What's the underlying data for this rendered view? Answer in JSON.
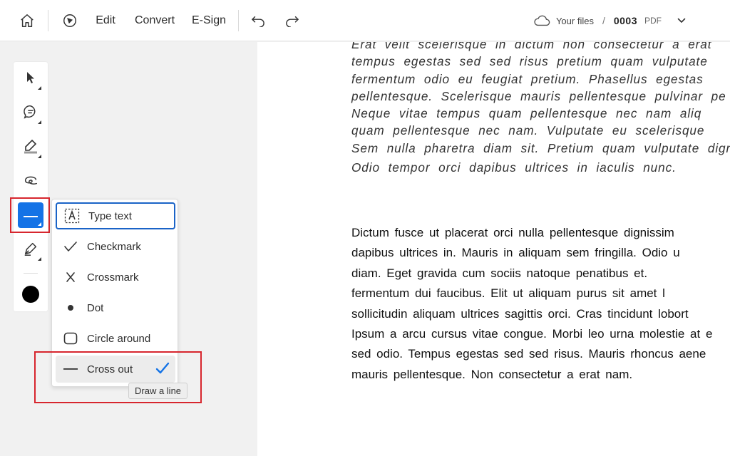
{
  "toolbar": {
    "home_icon": "home-icon",
    "nav_icon": "compass-icon",
    "edit_label": "Edit",
    "convert_label": "Convert",
    "esign_label": "E-Sign",
    "undo_icon": "undo-icon",
    "redo_icon": "redo-icon"
  },
  "file": {
    "cloud_icon": "cloud-icon",
    "location_label": "Your files",
    "separator": "/",
    "name": "0003",
    "type": "PDF",
    "dropdown_icon": "chevron-down-icon"
  },
  "left_tools": [
    {
      "name": "select-tool",
      "icon": "pointer-icon"
    },
    {
      "name": "comment-tool",
      "icon": "comment-icon"
    },
    {
      "name": "highlight-tool",
      "icon": "highlighter-icon"
    },
    {
      "name": "draw-tool",
      "icon": "freehand-icon"
    },
    {
      "name": "markup-tool",
      "icon": "line-icon",
      "active": true
    },
    {
      "name": "sign-tool",
      "icon": "pen-icon"
    }
  ],
  "current_color": "#000000",
  "accent_color": "#1473e6",
  "highlight_color": "#d7262e",
  "menu": {
    "items": [
      {
        "label": "Type text",
        "icon": "type-text-icon",
        "focused": true
      },
      {
        "label": "Checkmark",
        "icon": "checkmark-icon"
      },
      {
        "label": "Crossmark",
        "icon": "crossmark-icon"
      },
      {
        "label": "Dot",
        "icon": "dot-icon"
      },
      {
        "label": "Circle around",
        "icon": "circle-icon"
      },
      {
        "label": "Cross out",
        "icon": "strikeout-line-icon",
        "selected": true
      }
    ],
    "tooltip": "Draw a line"
  },
  "document": {
    "italic_lines": [
      "Erat velit scelerisque in dictum non consectetur a erat",
      "tempus egestas sed sed risus pretium quam vulputate",
      "fermentum odio eu feugiat pretium. Phasellus egestas",
      "pellentesque. Scelerisque mauris pellentesque pulvinar pe",
      "Neque vitae tempus quam pellentesque nec nam aliq",
      "quam pellentesque nec nam. Vulputate eu scelerisque",
      "Sem nulla pharetra diam sit. Pretium quam vulputate dignis",
      "Odio tempor orci dapibus ultrices in iaculis nunc."
    ],
    "normal_lines": [
      "Dictum fusce ut placerat orci nulla pellentesque dignissim",
      "dapibus ultrices in. Mauris in aliquam sem fringilla. Odio u",
      "diam. Eget gravida cum sociis natoque penatibus et.",
      "fermentum dui faucibus. Elit ut aliquam purus sit amet l",
      "sollicitudin aliquam ultrices sagittis orci. Cras tincidunt lobort",
      "Ipsum a arcu cursus vitae congue. Morbi leo urna molestie at e",
      "sed odio. Tempus egestas sed sed risus. Mauris rhoncus aene",
      "mauris pellentesque. Non consectetur a erat nam."
    ]
  }
}
